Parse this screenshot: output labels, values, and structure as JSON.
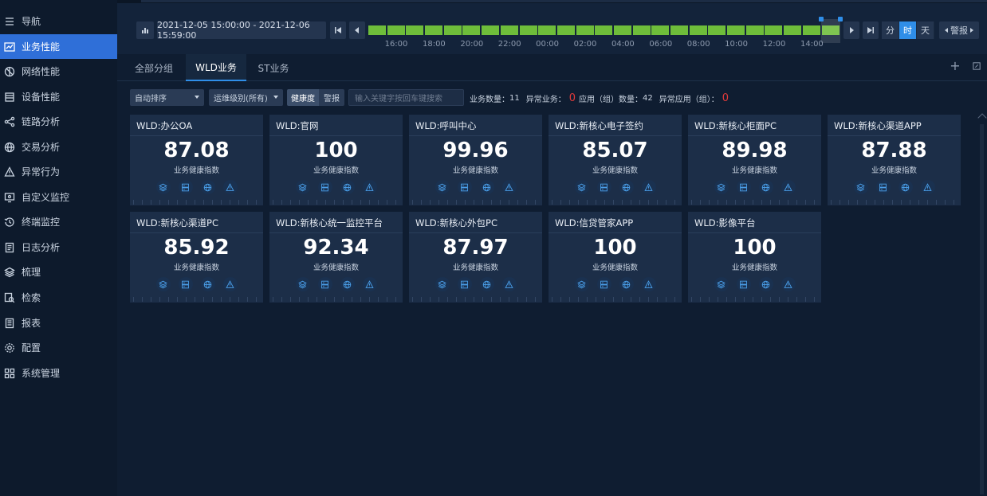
{
  "sidebar": {
    "items": [
      {
        "label": "导航",
        "icon": "menu-icon"
      },
      {
        "label": "业务性能",
        "icon": "chart-line-icon"
      },
      {
        "label": "网络性能",
        "icon": "network-icon"
      },
      {
        "label": "设备性能",
        "icon": "device-icon"
      },
      {
        "label": "链路分析",
        "icon": "share-icon"
      },
      {
        "label": "交易分析",
        "icon": "globe-icon"
      },
      {
        "label": "异常行为",
        "icon": "warning-icon"
      },
      {
        "label": "自定义监控",
        "icon": "monitor-icon"
      },
      {
        "label": "终端监控",
        "icon": "history-icon"
      },
      {
        "label": "日志分析",
        "icon": "document-icon"
      },
      {
        "label": "梳理",
        "icon": "layers-icon"
      },
      {
        "label": "检索",
        "icon": "search-doc-icon"
      },
      {
        "label": "报表",
        "icon": "report-icon"
      },
      {
        "label": "配置",
        "icon": "gear-icon"
      },
      {
        "label": "系统管理",
        "icon": "grid-icon"
      }
    ],
    "active_index": 1
  },
  "timebar": {
    "range": "2021-12-05 15:00:00 - 2021-12-06 15:59:00",
    "hours": [
      "16:00",
      "18:00",
      "20:00",
      "22:00",
      "00:00",
      "02:00",
      "04:00",
      "06:00",
      "08:00",
      "10:00",
      "12:00",
      "14:00"
    ],
    "granularity": [
      "分",
      "时",
      "天"
    ],
    "granularity_active": "时",
    "alert_label": "警报",
    "slot_color": "#6ebd3a"
  },
  "tabs": [
    {
      "label": "全部分组"
    },
    {
      "label": "WLD业务"
    },
    {
      "label": "ST业务"
    }
  ],
  "filters": {
    "sort": "自动排序",
    "level": "运维级别(所有)",
    "toggle": [
      "健康度",
      "警报"
    ],
    "search_placeholder": "输入关键字按回车键搜索",
    "stats": {
      "business_count_label": "业务数量：",
      "business_count": "11",
      "abnormal_business_label": "异常业务：",
      "abnormal_business": "0",
      "app_count_label": "应用（组）数量：",
      "app_count": "42",
      "abnormal_app_label": "异常应用（组）：",
      "abnormal_app": "0"
    }
  },
  "cards": [
    {
      "title": "WLD:办公OA",
      "score": "87.08",
      "subtitle": "业务健康指数"
    },
    {
      "title": "WLD:官网",
      "score": "100",
      "subtitle": "业务健康指数"
    },
    {
      "title": "WLD:呼叫中心",
      "score": "99.96",
      "subtitle": "业务健康指数"
    },
    {
      "title": "WLD:新核心电子签约",
      "score": "85.07",
      "subtitle": "业务健康指数"
    },
    {
      "title": "WLD:新核心柜面PC",
      "score": "89.98",
      "subtitle": "业务健康指数"
    },
    {
      "title": "WLD:新核心渠道APP",
      "score": "87.88",
      "subtitle": "业务健康指数"
    },
    {
      "title": "WLD:新核心渠道PC",
      "score": "85.92",
      "subtitle": "业务健康指数"
    },
    {
      "title": "WLD:新核心统一监控平台",
      "score": "92.34",
      "subtitle": "业务健康指数"
    },
    {
      "title": "WLD:新核心外包PC",
      "score": "87.97",
      "subtitle": "业务健康指数"
    },
    {
      "title": "WLD:信贷管家APP",
      "score": "100",
      "subtitle": "业务健康指数"
    },
    {
      "title": "WLD:影像平台",
      "score": "100",
      "subtitle": "业务健康指数"
    }
  ],
  "card_icons": [
    "layers-icon",
    "server-icon",
    "globe-icon",
    "warning-icon"
  ]
}
